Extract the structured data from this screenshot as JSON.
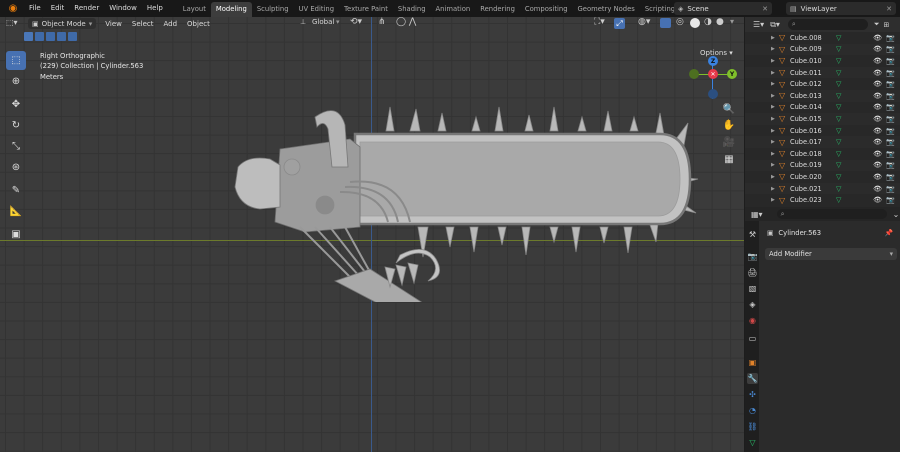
{
  "menus": [
    "File",
    "Edit",
    "Render",
    "Window",
    "Help"
  ],
  "workspaces": [
    {
      "label": "Layout",
      "active": false
    },
    {
      "label": "Modeling",
      "active": true
    },
    {
      "label": "Sculpting",
      "active": false
    },
    {
      "label": "UV Editing",
      "active": false
    },
    {
      "label": "Texture Paint",
      "active": false
    },
    {
      "label": "Shading",
      "active": false
    },
    {
      "label": "Animation",
      "active": false
    },
    {
      "label": "Rendering",
      "active": false
    },
    {
      "label": "Compositing",
      "active": false
    },
    {
      "label": "Geometry Nodes",
      "active": false
    },
    {
      "label": "Scripting",
      "active": false
    }
  ],
  "add_workspace": "+",
  "scene": "Scene",
  "view_layer": "ViewLayer",
  "viewport_header": {
    "mode": "Object Mode",
    "items": [
      "View",
      "Select",
      "Add",
      "Object"
    ],
    "transform_orientation": "Global",
    "options": "Options"
  },
  "viewport_info": {
    "view": "Right Orthographic",
    "collection": "(229) Collection | Cylinder.563",
    "units": "Meters"
  },
  "gizmo": {
    "x": "X",
    "y": "Y",
    "z": "Z"
  },
  "outliner": [
    "Cube.008",
    "Cube.009",
    "Cube.010",
    "Cube.011",
    "Cube.012",
    "Cube.013",
    "Cube.014",
    "Cube.015",
    "Cube.016",
    "Cube.017",
    "Cube.018",
    "Cube.019",
    "Cube.020",
    "Cube.021",
    "Cube.023"
  ],
  "properties": {
    "object_name": "Cylinder.563",
    "add_modifier": "Add Modifier"
  },
  "colors": {
    "active_tab": "#3d3d3d",
    "accent_blue": "#4771b2",
    "object_orange": "#e0822a",
    "mesh_green": "#27c06a",
    "axis_x": "#e7394a",
    "axis_y": "#7fbf2a",
    "axis_z": "#3a82e0"
  }
}
